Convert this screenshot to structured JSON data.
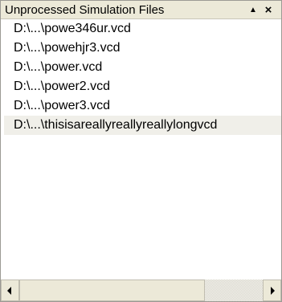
{
  "panel": {
    "title": "Unprocessed Simulation Files",
    "pin_glyph": "▲",
    "close_glyph": "×",
    "pin_icon": "pin-icon",
    "close_icon": "close-icon"
  },
  "files": [
    "D:\\...\\powe346ur.vcd",
    "D:\\...\\powehjr3.vcd",
    "D:\\...\\power.vcd",
    "D:\\...\\power2.vcd",
    "D:\\...\\power3.vcd",
    "D:\\...\\thisisareallyreallyreallylongvcd"
  ],
  "selected_index": 5,
  "scrollbar": {
    "horizontal_position": 0
  },
  "colors": {
    "titlebar_bg": "#ece9d8",
    "selected_bg": "#f0efe9",
    "border": "#9c9a94"
  }
}
